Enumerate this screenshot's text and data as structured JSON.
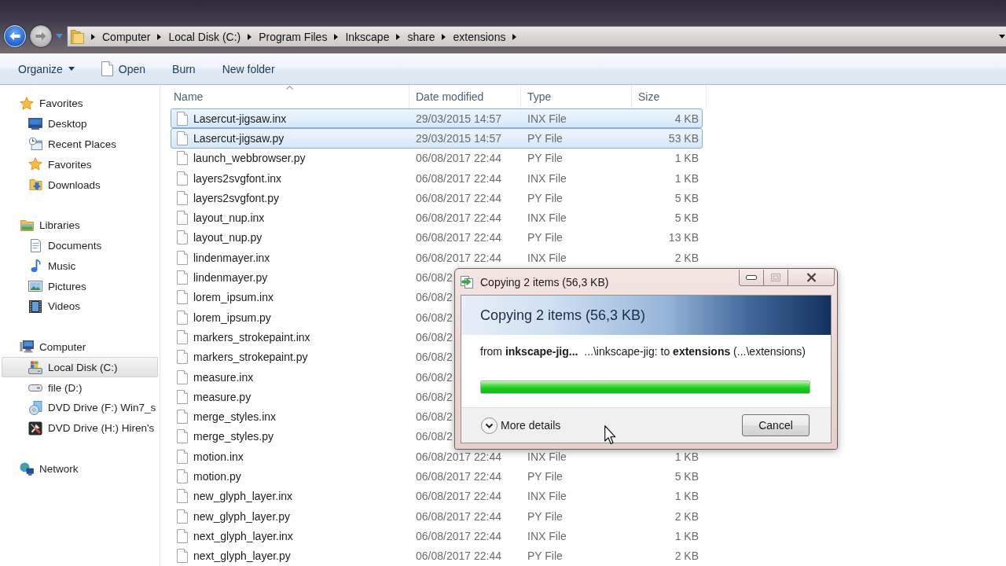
{
  "navigation": [
    {
      "kind": "back",
      "disabled": false
    },
    {
      "kind": "forward",
      "disabled": true
    }
  ],
  "address_bar": {
    "crumbs": [
      "Computer",
      "Local Disk (C:)",
      "Program Files",
      "Inkscape",
      "share",
      "extensions"
    ]
  },
  "toolbar": [
    {
      "label": "Organize",
      "kind": "menu"
    },
    {
      "label": "Open",
      "kind": "document"
    },
    {
      "label": "Burn",
      "kind": "plain"
    },
    {
      "label": "New folder",
      "kind": "plain"
    }
  ],
  "sidebar": {
    "groups": [
      {
        "label": "Favorites",
        "kind": "star",
        "selected": false,
        "children": [
          {
            "label": "Desktop",
            "kind": "desktop",
            "selected": false
          },
          {
            "label": "Recent Places",
            "kind": "recent",
            "selected": false
          },
          {
            "label": "Favorites",
            "kind": "star",
            "selected": false
          },
          {
            "label": "Downloads",
            "kind": "downloads",
            "selected": false
          }
        ]
      },
      {
        "label": "Libraries",
        "kind": "library",
        "selected": false,
        "children": [
          {
            "label": "Documents",
            "kind": "documents",
            "selected": false
          },
          {
            "label": "Music",
            "kind": "music",
            "selected": false
          },
          {
            "label": "Pictures",
            "kind": "pictures",
            "selected": false
          },
          {
            "label": "Videos",
            "kind": "videos",
            "selected": false
          }
        ]
      },
      {
        "label": "Computer",
        "kind": "computer",
        "selected": false,
        "children": [
          {
            "label": "Local Disk (C:)",
            "kind": "system-drive",
            "selected": true
          },
          {
            "label": "file (D:)",
            "kind": "drive",
            "selected": false
          },
          {
            "label": "DVD Drive (F:) Win7_s",
            "kind": "dvd",
            "selected": false
          },
          {
            "label": "DVD Drive (H:) Hiren's",
            "kind": "tools",
            "selected": false
          }
        ]
      },
      {
        "label": "Network",
        "kind": "network",
        "selected": false
      }
    ]
  },
  "file_list": {
    "columns": [
      {
        "label": "Name",
        "sorted": true
      },
      {
        "label": "Date modified",
        "sorted": false
      },
      {
        "label": "Type",
        "sorted": false
      },
      {
        "label": "Size",
        "sorted": false
      }
    ],
    "rows": [
      {
        "name": "Lasercut-jigsaw.inx",
        "date": "29/03/2015 14:57",
        "type": "INX File",
        "size": "4 KB",
        "selected": true
      },
      {
        "name": "Lasercut-jigsaw.py",
        "date": "29/03/2015 14:57",
        "type": "PY File",
        "size": "53 KB",
        "selected": true
      },
      {
        "name": "launch_webbrowser.py",
        "date": "06/08/2017 22:44",
        "type": "PY File",
        "size": "1 KB",
        "selected": false
      },
      {
        "name": "layers2svgfont.inx",
        "date": "06/08/2017 22:44",
        "type": "INX File",
        "size": "1 KB",
        "selected": false
      },
      {
        "name": "layers2svgfont.py",
        "date": "06/08/2017 22:44",
        "type": "PY File",
        "size": "5 KB",
        "selected": false
      },
      {
        "name": "layout_nup.inx",
        "date": "06/08/2017 22:44",
        "type": "INX File",
        "size": "5 KB",
        "selected": false
      },
      {
        "name": "layout_nup.py",
        "date": "06/08/2017 22:44",
        "type": "PY File",
        "size": "13 KB",
        "selected": false
      },
      {
        "name": "lindenmayer.inx",
        "date": "06/08/2017 22:44",
        "type": "INX File",
        "size": "2 KB",
        "selected": false
      },
      {
        "name": "lindenmayer.py",
        "date": "06/08/2",
        "selected": false
      },
      {
        "name": "lorem_ipsum.inx",
        "date": "06/08/2",
        "selected": false
      },
      {
        "name": "lorem_ipsum.py",
        "date": "06/08/2",
        "selected": false
      },
      {
        "name": "markers_strokepaint.inx",
        "date": "06/08/2",
        "selected": false
      },
      {
        "name": "markers_strokepaint.py",
        "date": "06/08/2",
        "selected": false
      },
      {
        "name": "measure.inx",
        "date": "06/08/2",
        "selected": false
      },
      {
        "name": "measure.py",
        "date": "06/08/2",
        "selected": false
      },
      {
        "name": "merge_styles.inx",
        "date": "06/08/2",
        "selected": false
      },
      {
        "name": "merge_styles.py",
        "date": "06/08/2",
        "selected": false
      },
      {
        "name": "motion.inx",
        "date": "06/08/2017 22:44",
        "type": "INX File",
        "size": "1 KB",
        "selected": false
      },
      {
        "name": "motion.py",
        "date": "06/08/2017 22:44",
        "type": "PY File",
        "size": "5 KB",
        "selected": false
      },
      {
        "name": "new_glyph_layer.inx",
        "date": "06/08/2017 22:44",
        "type": "INX File",
        "size": "1 KB",
        "selected": false
      },
      {
        "name": "new_glyph_layer.py",
        "date": "06/08/2017 22:44",
        "type": "PY File",
        "size": "2 KB",
        "selected": false
      },
      {
        "name": "next_glyph_layer.inx",
        "date": "06/08/2017 22:44",
        "type": "INX File",
        "size": "1 KB",
        "selected": false
      },
      {
        "name": "next_glyph_layer.py",
        "date": "06/08/2017 22:44",
        "type": "PY File",
        "size": "2 KB",
        "selected": false
      }
    ]
  },
  "copy_dialog": {
    "title": "Copying 2 items (56,3 KB)",
    "window_buttons": [
      {
        "kind": "minimize",
        "disabled": false
      },
      {
        "kind": "maximize",
        "disabled": true
      },
      {
        "kind": "close",
        "disabled": false
      }
    ],
    "heading": "Copying 2 items (56,3 KB)",
    "detail": "from **inkscape-jig...**  ...\\inkscape-jig: to **extensions** (...\\extensions)",
    "progress": {
      "level": 1
    },
    "more_details": {
      "label": "More details",
      "expanded": false
    },
    "cancel_button": "Cancel"
  }
}
